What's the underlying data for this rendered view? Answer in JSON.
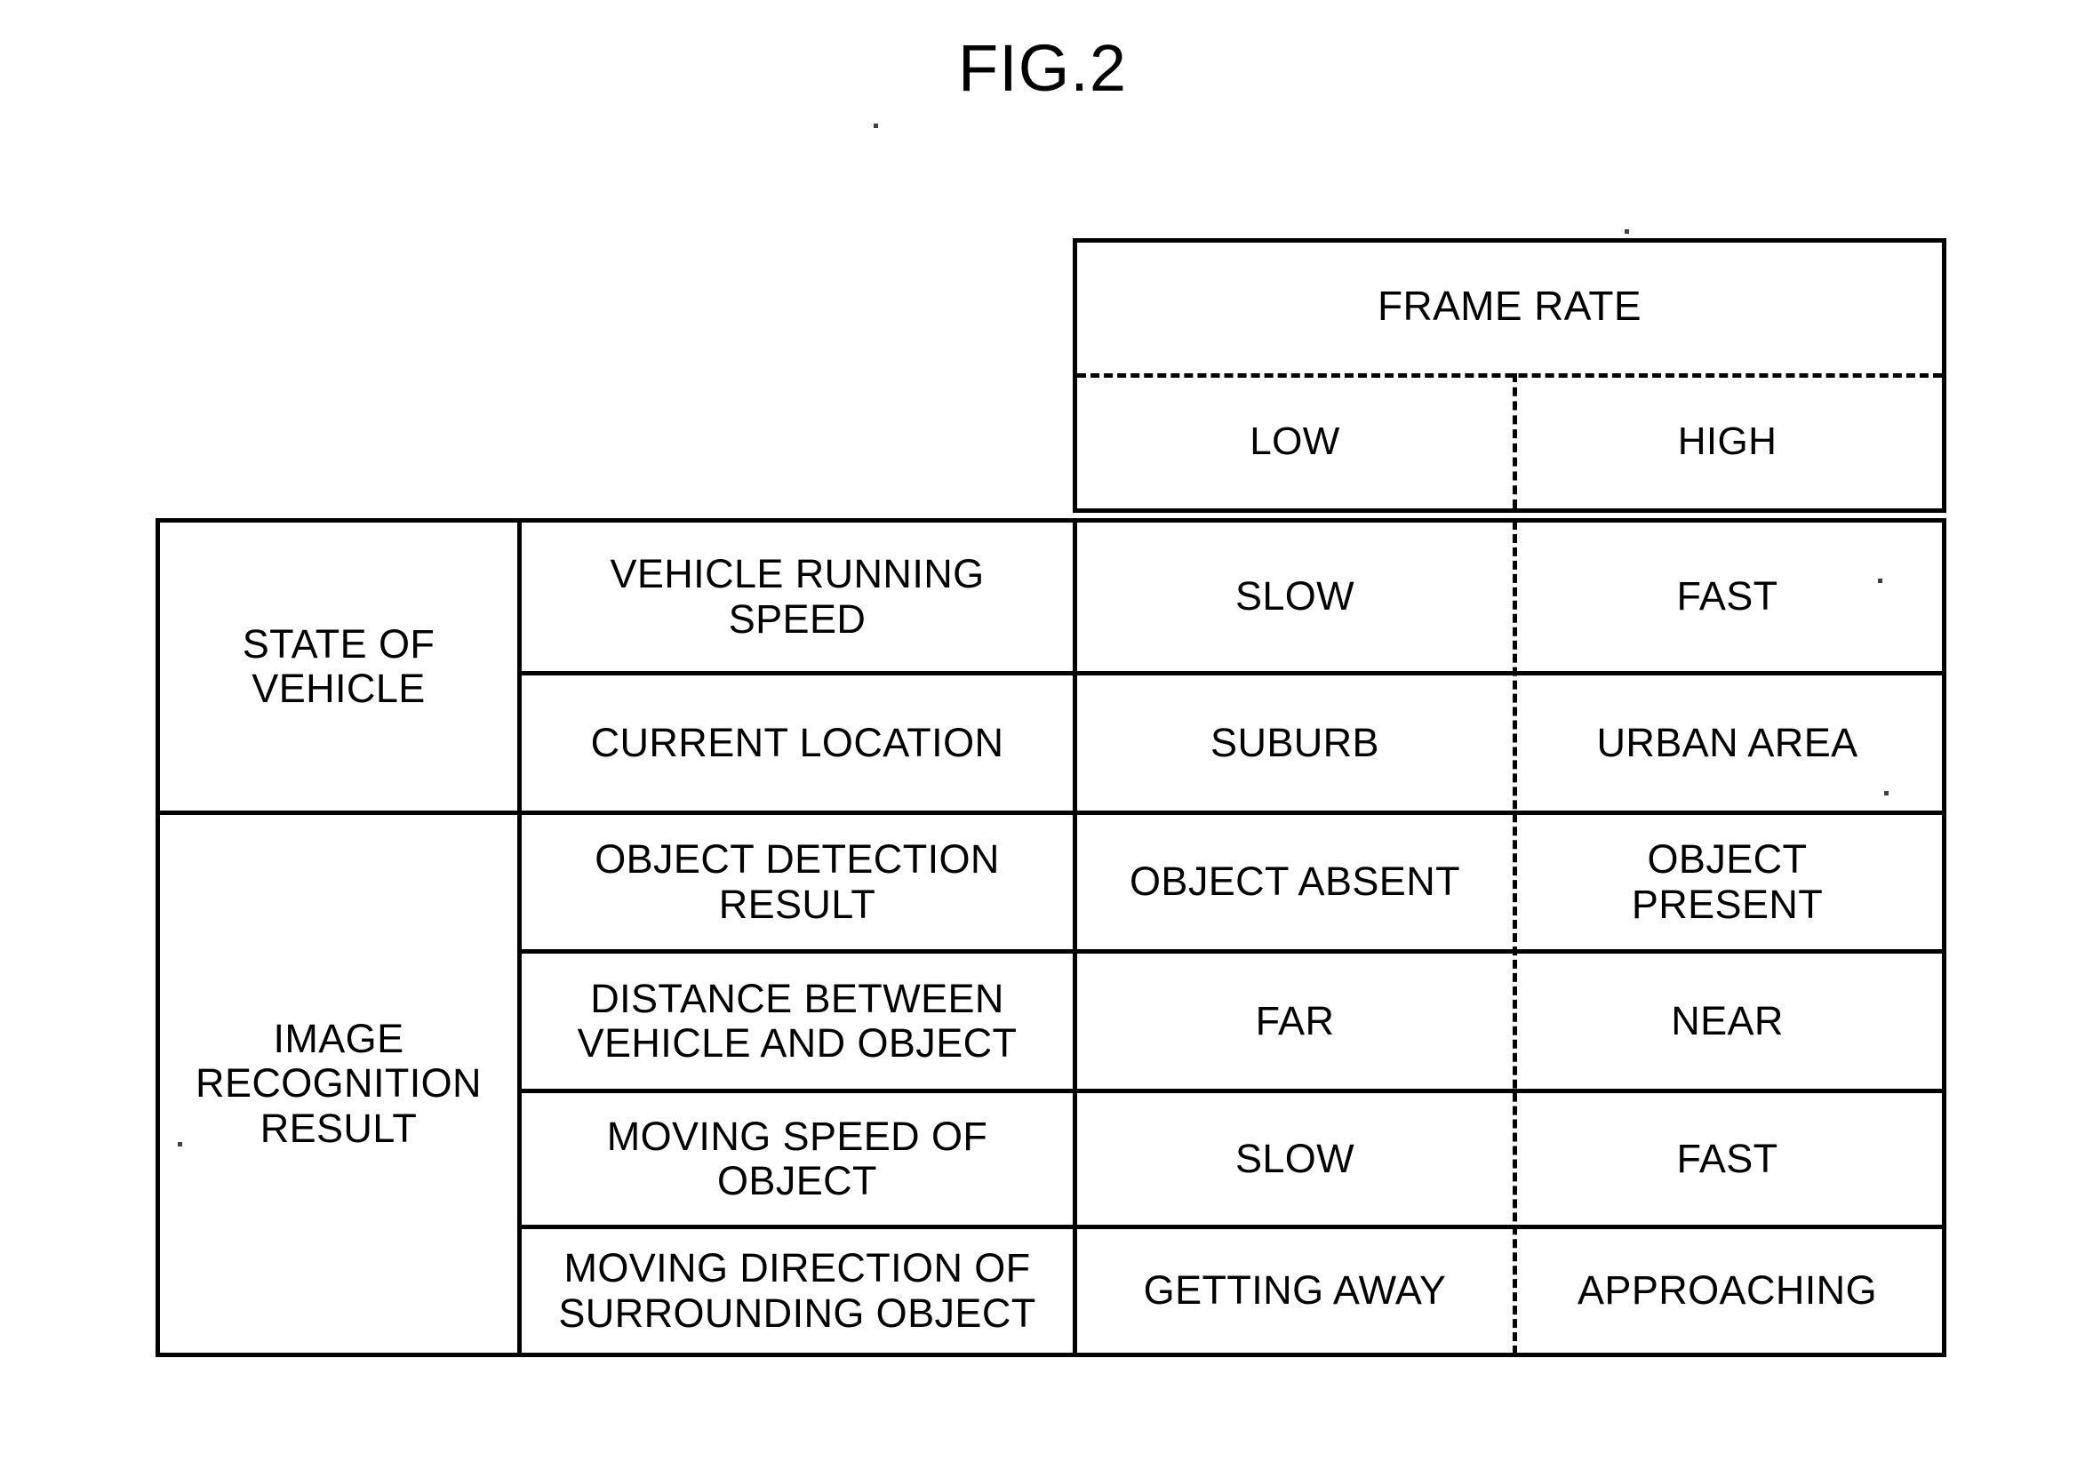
{
  "figure": {
    "title": "FIG.2"
  },
  "table": {
    "header": {
      "main_label": "FRAME RATE",
      "sub_labels": [
        "LOW",
        "HIGH"
      ]
    },
    "row_groups": [
      {
        "label": "STATE OF\nVEHICLE",
        "rows": [
          {
            "parameter": "VEHICLE RUNNING\nSPEED",
            "low": "SLOW",
            "high": "FAST"
          },
          {
            "parameter": "CURRENT LOCATION",
            "low": "SUBURB",
            "high": "URBAN AREA"
          }
        ]
      },
      {
        "label": "IMAGE\nRECOGNITION\nRESULT",
        "rows": [
          {
            "parameter": "OBJECT DETECTION\nRESULT",
            "low": "OBJECT ABSENT",
            "high": "OBJECT\nPRESENT"
          },
          {
            "parameter": "DISTANCE BETWEEN\nVEHICLE AND OBJECT",
            "low": "FAR",
            "high": "NEAR"
          },
          {
            "parameter": "MOVING SPEED OF\nOBJECT",
            "low": "SLOW",
            "high": "FAST"
          },
          {
            "parameter": "MOVING DIRECTION OF\nSURROUNDING OBJECT",
            "low": "GETTING AWAY",
            "high": "APPROACHING"
          }
        ]
      }
    ]
  },
  "colors": {
    "ink": "#000000",
    "paper": "#ffffff"
  }
}
